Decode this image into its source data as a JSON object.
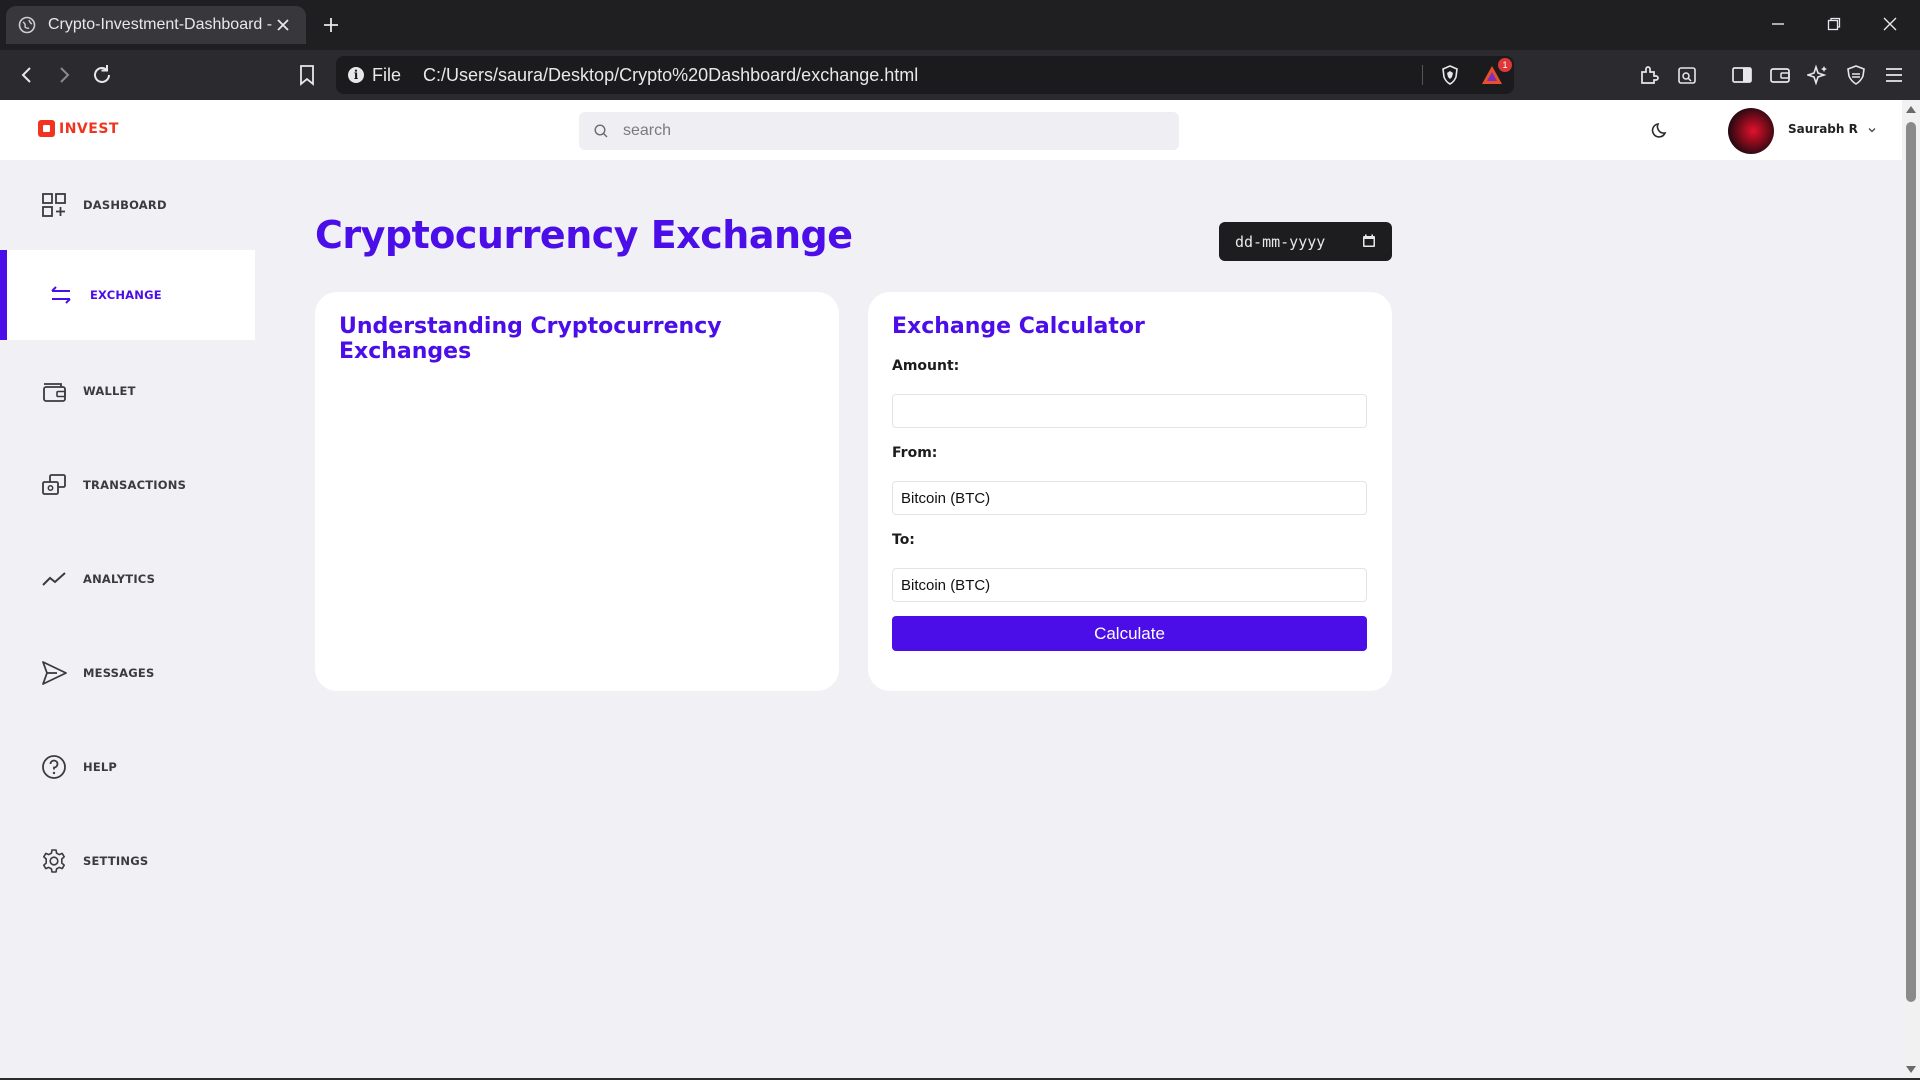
{
  "browser": {
    "tab_title": "Crypto-Investment-Dashboard -",
    "url_scheme": "File",
    "url": "C:/Users/saura/Desktop/Crypto%20Dashboard/exchange.html",
    "rewards_badge": "1"
  },
  "header": {
    "logo_text": "INVEST",
    "search_placeholder": "search",
    "user_name": "Saurabh R"
  },
  "sidebar": {
    "items": [
      {
        "label": "DASHBOARD",
        "icon": "dashboard-grid-icon",
        "active": false
      },
      {
        "label": "EXCHANGE",
        "icon": "exchange-arrows-icon",
        "active": true
      },
      {
        "label": "WALLET",
        "icon": "wallet-icon",
        "active": false
      },
      {
        "label": "TRANSACTIONS",
        "icon": "transactions-icon",
        "active": false
      },
      {
        "label": "ANALYTICS",
        "icon": "analytics-trend-icon",
        "active": false
      },
      {
        "label": "MESSAGES",
        "icon": "send-icon",
        "active": false
      },
      {
        "label": "HELP",
        "icon": "help-circle-icon",
        "active": false
      },
      {
        "label": "SETTINGS",
        "icon": "gear-icon",
        "active": false
      }
    ]
  },
  "main": {
    "title": "Cryptocurrency Exchange",
    "date_placeholder": "dd-mm-yyyy",
    "info_card": {
      "title": "Understanding Cryptocurrency Exchanges"
    },
    "calculator": {
      "title": "Exchange Calculator",
      "amount_label": "Amount:",
      "amount_value": "",
      "from_label": "From:",
      "from_value": "Bitcoin (BTC)",
      "to_label": "To:",
      "to_value": "Bitcoin (BTC)",
      "button_label": "Calculate"
    }
  },
  "colors": {
    "accent": "#4b0ee8",
    "brand": "#f0341f",
    "page_bg": "#f0f0f5"
  }
}
